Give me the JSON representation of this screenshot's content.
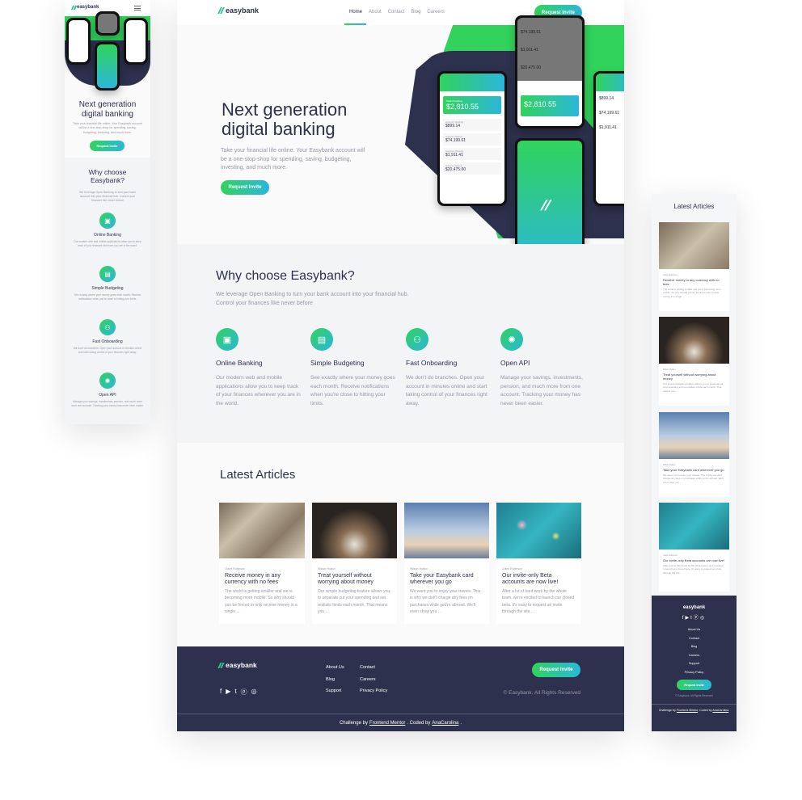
{
  "brand": {
    "name": "easybank",
    "accent_green": "#31d35c",
    "accent_cyan": "#2bb7da",
    "dark_blue": "#2d314d"
  },
  "nav": {
    "items": [
      "Home",
      "About",
      "Contact",
      "Blog",
      "Careers"
    ],
    "active": "Home",
    "cta": "Request Invite"
  },
  "hero": {
    "title_line1": "Next generation",
    "title_line2": "digital banking",
    "text": "Take your financial life online. Your Easybank account will be a one-stop-shop for spending, saving, budgeting, investing, and much more.",
    "cta": "Request Invite",
    "phone": {
      "total_label": "Total Checking",
      "total": "$2,810.55",
      "accounts": [
        {
          "label": "Account 1 Checking",
          "amount": "$899.14"
        },
        {
          "label": "Account 2 Savings",
          "amount": "$74,199.61"
        },
        {
          "label": "Account 3 Checking",
          "amount": "$1,911.41"
        },
        {
          "label": "Account 4 Savings",
          "amount": "$20,475.00"
        }
      ]
    }
  },
  "why": {
    "title": "Why choose Easybank?",
    "text": "We leverage Open Banking to turn your bank account into your financial hub. Control your finances like never before",
    "features": [
      {
        "icon": "online-banking-icon",
        "title": "Online Banking",
        "text": "Our modern web and mobile applications allow you to keep track of your finances wherever you are in the world."
      },
      {
        "icon": "budgeting-icon",
        "title": "Simple Budgeting",
        "text": "See exactly where your money goes each month. Receive notifications when you're close to hitting your limits."
      },
      {
        "icon": "onboarding-icon",
        "title": "Fast Onboarding",
        "text": "We don't do branches. Open your account in minutes online and start taking control of your finances right away."
      },
      {
        "icon": "api-icon",
        "title": "Open API",
        "text": "Manage your savings, investments, pension, and much more from one account. Tracking your money has never been easier."
      }
    ]
  },
  "articles": {
    "title": "Latest Articles",
    "items": [
      {
        "author": "Claire Robinson",
        "title": "Receive money in any currency with no fees",
        "text": "The world is getting smaller and we're becoming more mobile. So why should you be forced to only receive money in a single ..."
      },
      {
        "author": "Wilson Hutton",
        "title": "Treat yourself without worrying about money",
        "text": "Our simple budgeting feature allows you to separate out your spending and set realistic limits each month. That means you ..."
      },
      {
        "author": "Wilson Hutton",
        "title": "Take your Easybank card wherever you go",
        "text": "We want you to enjoy your travels. This is why we don't charge any fees on purchases while you're abroad. We'll even show you ..."
      },
      {
        "author": "Claire Robinson",
        "title": "Our invite-only Beta accounts are now live!",
        "text": "After a lot of hard work by the whole team, we're excited to launch our closed beta. It's easy to request an invite through the site ..."
      }
    ]
  },
  "footer": {
    "links": [
      "About Us",
      "Contact",
      "Blog",
      "Careers",
      "Support",
      "Privacy Policy"
    ],
    "social": [
      "facebook-icon",
      "youtube-icon",
      "twitter-icon",
      "pinterest-icon",
      "instagram-icon"
    ],
    "cta": "Request Invite",
    "copyright": "© Easybank. All Rights Reserved",
    "attribution": {
      "prefix": "Challenge by",
      "fm": "Frontend Mentor",
      "mid": ". Coded by",
      "author": "AnaCarolina",
      "end": "."
    }
  }
}
